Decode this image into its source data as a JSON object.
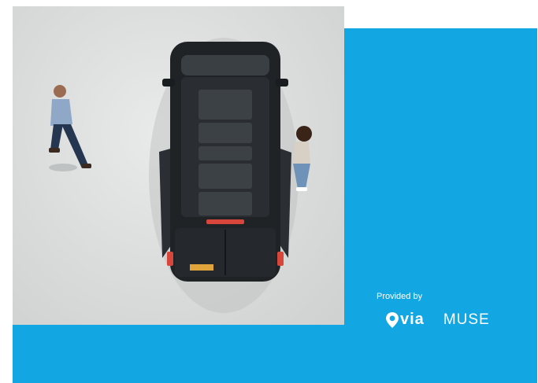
{
  "provided_by_label": "Provided by",
  "logos": {
    "via_text": "via",
    "muse_text": "MUSE"
  },
  "colors": {
    "brand_blue": "#12a6e3",
    "background": "#ffffff"
  }
}
